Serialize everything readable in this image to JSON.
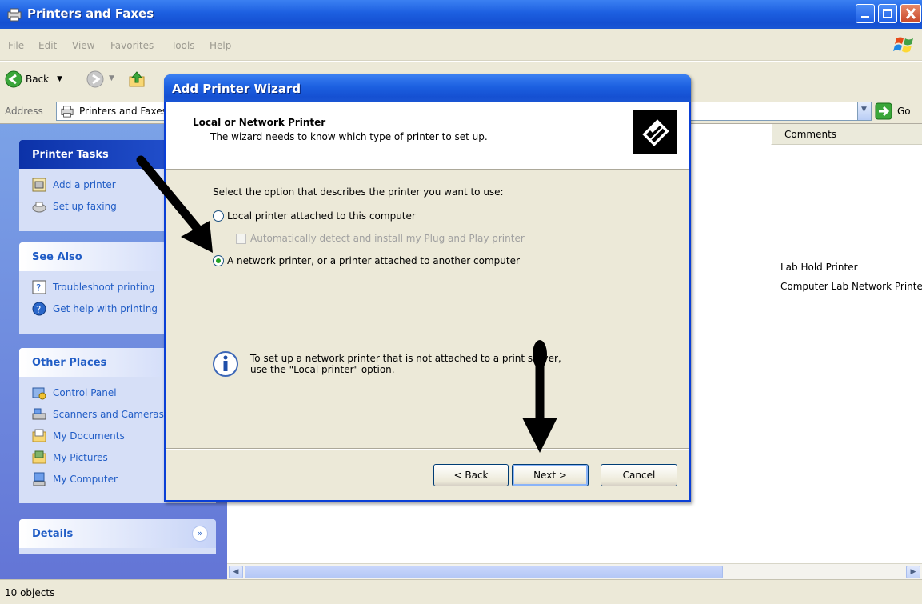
{
  "window": {
    "title": "Printers and Faxes"
  },
  "menu": {
    "items": [
      "File",
      "Edit",
      "View",
      "Favorites",
      "Tools",
      "Help"
    ]
  },
  "toolbar": {
    "back_label": "Back"
  },
  "address": {
    "label": "Address",
    "value": "Printers and Faxes",
    "go_label": "Go"
  },
  "taskpane": {
    "printer_tasks": {
      "title": "Printer Tasks",
      "items": [
        "Add a printer",
        "Set up faxing"
      ]
    },
    "see_also": {
      "title": "See Also",
      "items": [
        "Troubleshoot printing",
        "Get help with printing"
      ]
    },
    "other_places": {
      "title": "Other Places",
      "items": [
        "Control Panel",
        "Scanners and Cameras",
        "My Documents",
        "My Pictures",
        "My Computer"
      ]
    },
    "details": {
      "title": "Details"
    }
  },
  "content": {
    "column_header": "Comments",
    "comments": [
      "Lab Hold Printer",
      "Computer Lab Network Printer"
    ]
  },
  "status": {
    "text": "10 objects"
  },
  "wizard": {
    "title": "Add Printer Wizard",
    "header_title": "Local or Network Printer",
    "header_subtitle": "The wizard needs to know which type of printer to set up.",
    "prompt": "Select the option that describes the printer you want to use:",
    "option_local": "Local printer attached to this computer",
    "option_autodetect": "Automatically detect and install my Plug and Play printer",
    "option_network": "A network printer, or a printer attached to another computer",
    "selected_option": "network",
    "info_text": "To set up a network printer that is not attached to a print server,\nuse the \"Local printer\" option.",
    "back_button": "< Back",
    "next_button": "Next >",
    "cancel_button": "Cancel"
  }
}
